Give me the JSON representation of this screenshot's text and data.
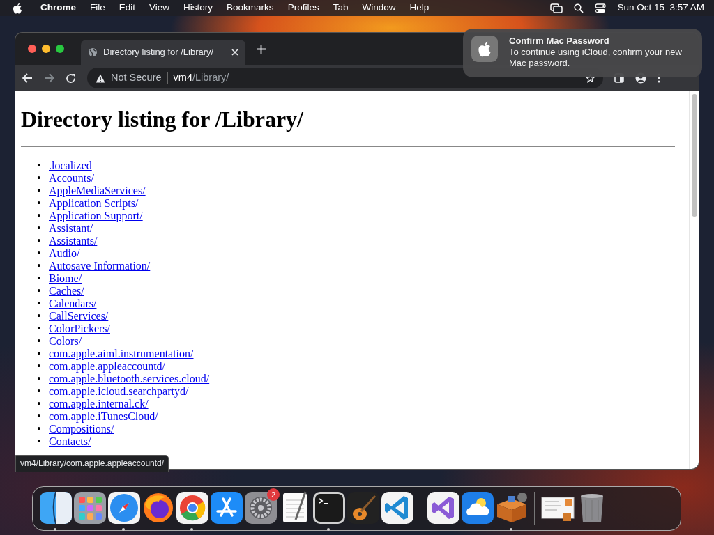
{
  "menu_bar": {
    "app_name": "Chrome",
    "items": [
      "File",
      "Edit",
      "View",
      "History",
      "Bookmarks",
      "Profiles",
      "Tab",
      "Window",
      "Help"
    ],
    "clock": "Sun Oct 15  3:57 AM"
  },
  "browser": {
    "tab": {
      "title": "Directory listing for /Library/",
      "selected": true
    },
    "address_bar": {
      "security": "Not Secure",
      "host": "vm4",
      "path": "/Library/"
    },
    "page": {
      "heading": "Directory listing for /Library/",
      "links": [
        {
          "marker": "•",
          "text": ".localized"
        },
        {
          "marker": "•",
          "text": "Accounts/"
        },
        {
          "marker": "•",
          "text": "AppleMediaServices/"
        },
        {
          "marker": "•",
          "text": "Application Scripts/"
        },
        {
          "marker": "•",
          "text": "Application Support/"
        },
        {
          "marker": "•",
          "text": "Assistant/"
        },
        {
          "marker": "•",
          "text": "Assistants/"
        },
        {
          "marker": "•",
          "text": "Audio/"
        },
        {
          "marker": "•",
          "text": "Autosave Information/"
        },
        {
          "marker": "•",
          "text": "Biome/"
        },
        {
          "marker": "•",
          "text": "Caches/"
        },
        {
          "marker": "•",
          "text": "Calendars/"
        },
        {
          "marker": "•",
          "text": "CallServices/"
        },
        {
          "marker": "•",
          "text": "ColorPickers/"
        },
        {
          "marker": "•",
          "text": "Colors/"
        },
        {
          "marker": "•",
          "text": "com.apple.aiml.instrumentation/"
        },
        {
          "marker": "•",
          "text": "com.apple.appleaccountd/"
        },
        {
          "marker": "•",
          "text": "com.apple.bluetooth.services.cloud/"
        },
        {
          "marker": "•",
          "text": "com.apple.icloud.searchpartyd/"
        },
        {
          "marker": "•",
          "text": "com.apple.internal.ck/"
        },
        {
          "marker": "•",
          "text": "com.apple.iTunesCloud/"
        },
        {
          "marker": "•",
          "text": "Compositions/"
        },
        {
          "marker": "•",
          "text": "Contacts/"
        }
      ]
    },
    "status_url": "vm4/Library/com.apple.appleaccountd/"
  },
  "notification": {
    "title": "Confirm Mac Password",
    "body": "To continue using iCloud, confirm your new Mac password."
  },
  "dock": {
    "items": [
      {
        "kind": "finder",
        "running": true
      },
      {
        "kind": "launchpad",
        "running": false
      },
      {
        "kind": "safari",
        "running": true
      },
      {
        "kind": "firefox",
        "running": false
      },
      {
        "kind": "chrome",
        "running": true
      },
      {
        "kind": "appstore",
        "running": false
      },
      {
        "kind": "settings",
        "running": false,
        "badge": "2"
      },
      {
        "kind": "textedit",
        "running": false
      },
      {
        "kind": "terminal",
        "running": true
      },
      {
        "kind": "garageband",
        "running": false
      },
      {
        "kind": "vscode",
        "running": false
      },
      {
        "kind": "divider"
      },
      {
        "kind": "visualstudio",
        "running": false
      },
      {
        "kind": "weather",
        "running": false
      },
      {
        "kind": "xampp",
        "running": true
      },
      {
        "kind": "divider"
      },
      {
        "kind": "document",
        "running": false
      },
      {
        "kind": "trash",
        "running": false
      }
    ]
  }
}
